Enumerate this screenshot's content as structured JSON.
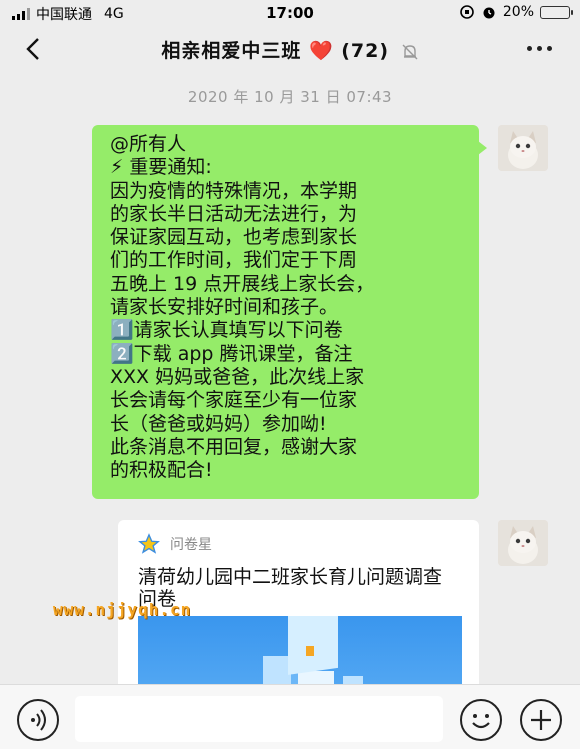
{
  "status_bar": {
    "carrier": "中国联通",
    "network": "4G",
    "time": "17:00",
    "battery": "20%",
    "battery_level": 0.2
  },
  "header": {
    "title_prefix": "相亲相爱中三班",
    "title_heart": "❤️",
    "member_count": "(72)"
  },
  "chat": {
    "timestamp": "2020 年 10 月 31 日 07:43",
    "message": {
      "lines": [
        "@所有人",
        "⚡ 重要通知:",
        "因为疫情的特殊情况，本学期",
        "的家长半日活动无法进行，为",
        "保证家园互动，也考虑到家长",
        "们的工作时间，我们定于下周",
        "五晚上 19 点开展线上家长会，",
        "请家长安排好时间和孩子。",
        "1️⃣请家长认真填写以下问卷",
        "2️⃣下载 app 腾讯课堂，备注",
        "XXX 妈妈或爸爸，此次线上家",
        "长会请每个家庭至少有一位家",
        "长（爸爸或妈妈）参加呦!",
        "此条消息不用回复，感谢大家",
        "的积极配合!"
      ]
    },
    "card": {
      "source": "问卷星",
      "title": "清荷幼儿园中二班家长育儿问题调查问卷"
    }
  },
  "watermark": "www.njjyqh.cn",
  "colors": {
    "bubble_green": "#95ec69",
    "background": "#ededed",
    "heart_red": "#e0242c"
  },
  "icons": [
    "back-icon",
    "mute-icon",
    "more-icon",
    "voice-icon",
    "emoji-icon",
    "plus-icon",
    "star-icon"
  ]
}
